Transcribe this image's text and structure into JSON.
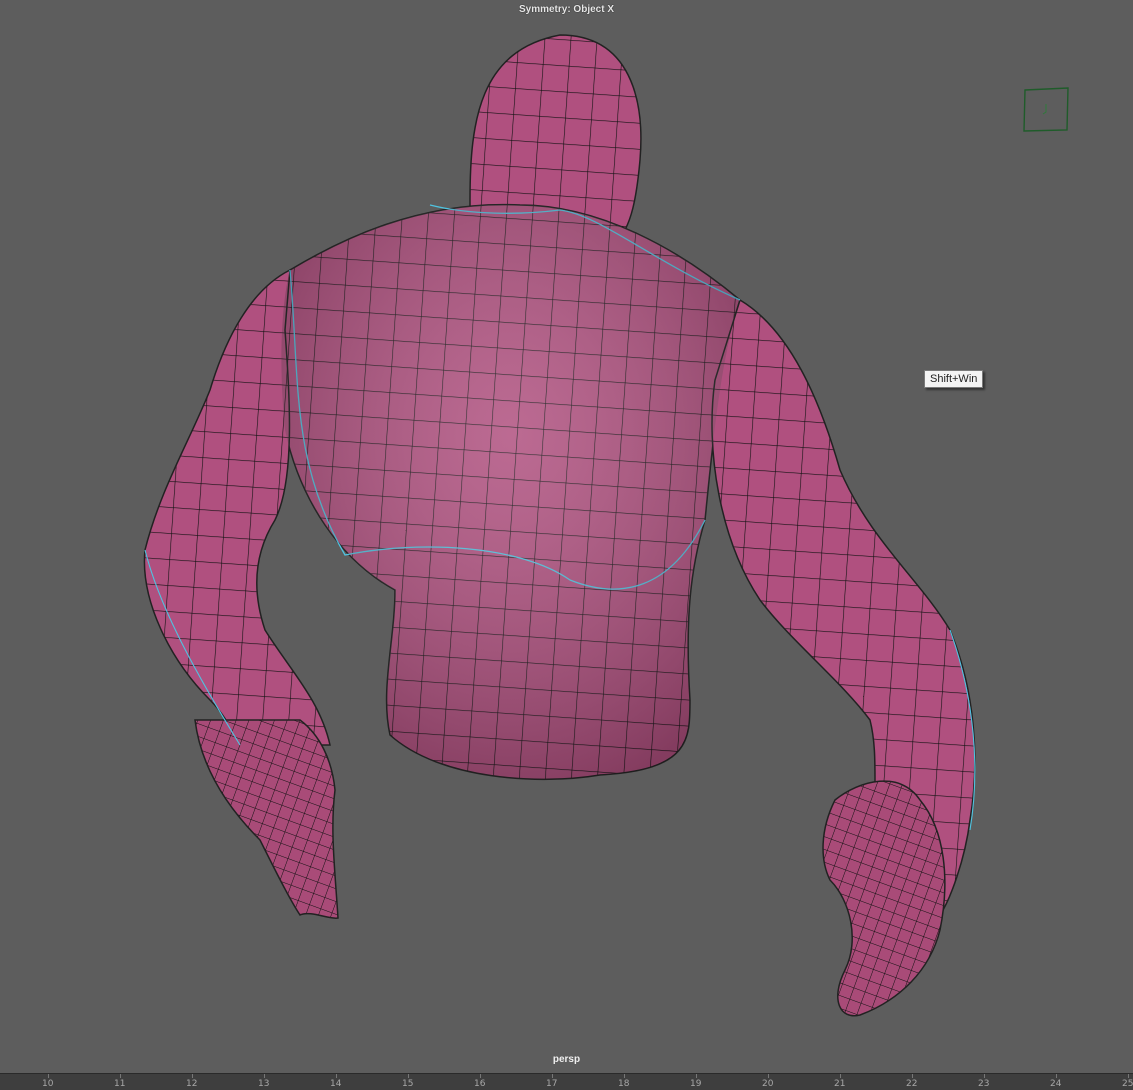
{
  "viewport": {
    "symmetry_label": "Symmetry: Object X",
    "camera_label": "persp",
    "tooltip": "Shift+Win"
  },
  "timeline": {
    "ticks": [
      "10",
      "11",
      "12",
      "13",
      "14",
      "15",
      "16",
      "17",
      "18",
      "19",
      "20",
      "21",
      "22",
      "23",
      "24",
      "25"
    ]
  },
  "colors": {
    "viewport_bg": "#5d5d5d",
    "mesh_fill": "#b0507f",
    "wire": "#111111",
    "seam": "#4fc3e0",
    "gizmo": "#1f5c2a"
  }
}
